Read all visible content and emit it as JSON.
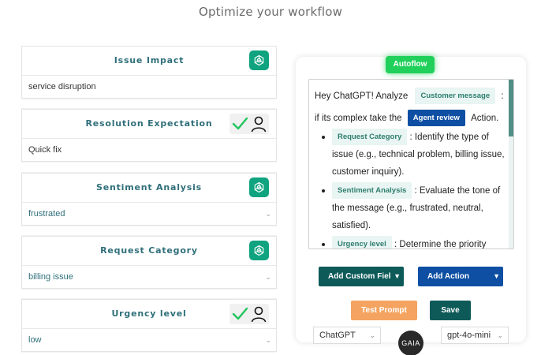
{
  "header": {
    "title": "Optimize your workflow"
  },
  "fields": [
    {
      "label": "Issue Impact",
      "value": "service disruption",
      "control": "gpt",
      "type": "text"
    },
    {
      "label": "Resolution Expectation",
      "value": "Quick fix",
      "control": "check-person",
      "type": "text"
    },
    {
      "label": "Sentiment Analysis",
      "value": "frustrated",
      "control": "gpt",
      "type": "select"
    },
    {
      "label": "Request Category",
      "value": "billing issue",
      "control": "gpt",
      "type": "select"
    },
    {
      "label": "Urgency level",
      "value": "low",
      "control": "check-person",
      "type": "select"
    }
  ],
  "panel": {
    "autoflow_label": "Autoflow",
    "prompt": {
      "line1_prefix": "Hey ChatGPT!  Analyze",
      "chip_customer": "Customer message",
      "line1_suffix": ":",
      "line2_prefix": "if its complex take the",
      "chip_agent": "Agent review",
      "line2_suffix": "Action.",
      "bullets": [
        {
          "chip": "Request Category",
          "text": ": Identify the type of issue (e.g., technical problem, billing issue, customer inquiry)."
        },
        {
          "chip": "Sentiment Analysis",
          "text": ": Evaluate the tone of the message (e.g., frustrated, neutral, satisfied)."
        },
        {
          "chip": "Urgency level",
          "text": ": Determine the priority"
        }
      ]
    },
    "add_custom_field_label": "Add Custom Field",
    "add_action_label": "Add Action",
    "test_prompt_label": "Test Prompt",
    "save_label": "Save"
  },
  "footer": {
    "provider_value": "ChatGPT",
    "model_value": "gpt-4o-mini",
    "logo_text": "GAIA"
  },
  "colors": {
    "accent_teal": "#0d5a59",
    "accent_blue": "#0e4fa3",
    "autoflow_green": "#20d05a",
    "test_orange": "#f4a460",
    "gpt_green": "#10a37f"
  }
}
